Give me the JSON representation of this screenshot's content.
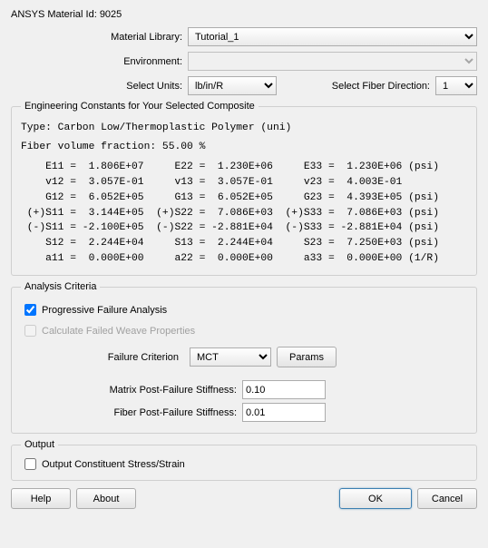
{
  "header": {
    "material_id_label": "ANSYS Material Id: 9025"
  },
  "top_form": {
    "material_library_label": "Material Library:",
    "material_library_value": "Tutorial_1",
    "environment_label": "Environment:",
    "environment_value": "",
    "select_units_label": "Select Units:",
    "select_units_value": "lb/in/R",
    "fiber_dir_label": "Select Fiber Direction:",
    "fiber_dir_value": "1"
  },
  "constants_group": {
    "legend": "Engineering Constants for Your Selected Composite",
    "type_line": "Type: Carbon Low/Thermoplastic Polymer (uni)",
    "fvf_line": "Fiber volume fraction: 55.00 %",
    "rows_text": "    E11 =  1.806E+07     E22 =  1.230E+06     E33 =  1.230E+06 (psi)\n    v12 =  3.057E-01     v13 =  3.057E-01     v23 =  4.003E-01\n    G12 =  6.052E+05     G13 =  6.052E+05     G23 =  4.393E+05 (psi)\n (+)S11 =  3.144E+05  (+)S22 =  7.086E+03  (+)S33 =  7.086E+03 (psi)\n (-)S11 = -2.100E+05  (-)S22 = -2.881E+04  (-)S33 = -2.881E+04 (psi)\n    S12 =  2.244E+04     S13 =  2.244E+04     S23 =  7.250E+03 (psi)\n    a11 =  0.000E+00     a22 =  0.000E+00     a33 =  0.000E+00 (1/R)"
  },
  "analysis": {
    "legend": "Analysis Criteria",
    "pfa_label": "Progressive Failure Analysis",
    "pfa_checked": true,
    "cfwp_label": "Calculate Failed Weave Properties",
    "cfwp_checked": false,
    "failure_crit_label": "Failure Criterion",
    "failure_crit_value": "MCT",
    "params_btn": "Params",
    "matrix_pf_label": "Matrix Post-Failure Stiffness:",
    "matrix_pf_value": "0.10",
    "fiber_pf_label": "Fiber Post-Failure Stiffness:",
    "fiber_pf_value": "0.01"
  },
  "output": {
    "legend": "Output",
    "ocss_label": "Output Constituent Stress/Strain",
    "ocss_checked": false
  },
  "footer": {
    "help": "Help",
    "about": "About",
    "ok": "OK",
    "cancel": "Cancel"
  }
}
